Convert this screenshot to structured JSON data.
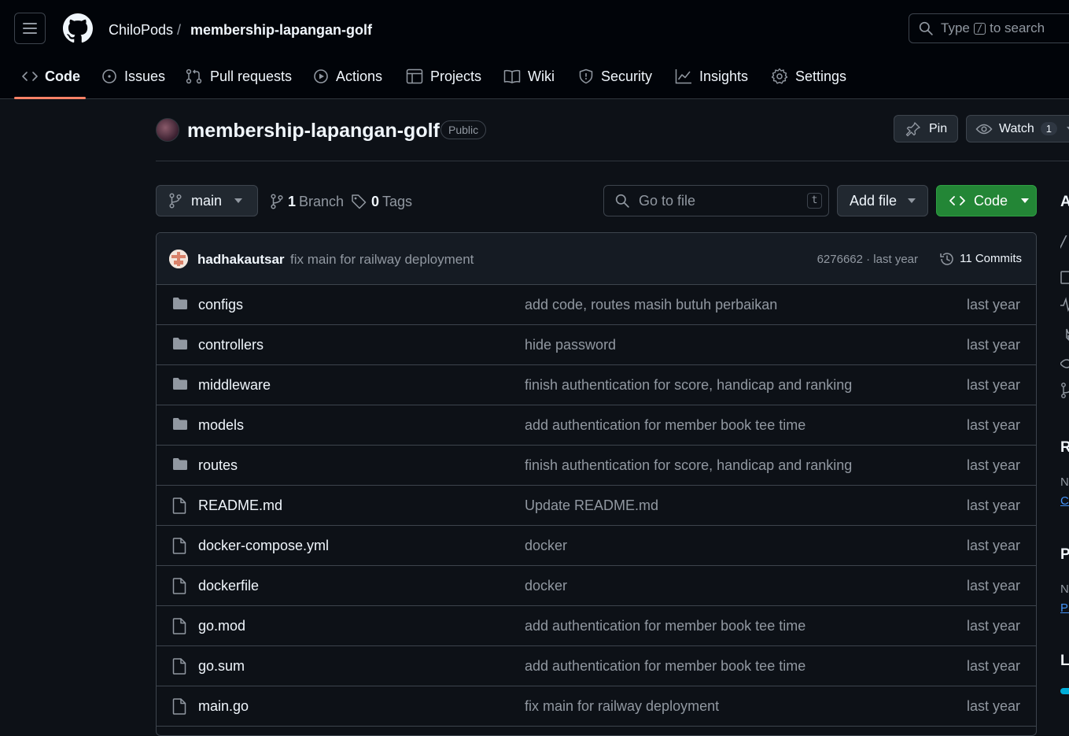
{
  "header": {
    "owner": "ChiloPods",
    "separator": "/",
    "repo": "membership-lapangan-golf",
    "search": {
      "prefix": "Type",
      "key": "/",
      "suffix": "to search"
    }
  },
  "tabs": [
    {
      "label": "Code",
      "icon": "code-icon",
      "selected": true
    },
    {
      "label": "Issues",
      "icon": "issue-icon"
    },
    {
      "label": "Pull requests",
      "icon": "pull-request-icon"
    },
    {
      "label": "Actions",
      "icon": "play-icon"
    },
    {
      "label": "Projects",
      "icon": "table-icon"
    },
    {
      "label": "Wiki",
      "icon": "book-icon"
    },
    {
      "label": "Security",
      "icon": "shield-icon"
    },
    {
      "label": "Insights",
      "icon": "graph-icon"
    },
    {
      "label": "Settings",
      "icon": "gear-icon"
    }
  ],
  "repo": {
    "title": "membership-lapangan-golf",
    "visibility": "Public",
    "pin_label": "Pin",
    "watch_label": "Watch",
    "watch_count": "1"
  },
  "toolbar": {
    "branch": "main",
    "branch_count": "1",
    "branch_label": "Branch",
    "tag_count": "0",
    "tag_label": "Tags",
    "goto_placeholder": "Go to file",
    "goto_key": "t",
    "add_file_label": "Add file",
    "code_label": "Code"
  },
  "latest_commit": {
    "author": "hadhakautsar",
    "message": "fix main for railway deployment",
    "hash_time": "6276662 · last year",
    "commits_label": "11 Commits"
  },
  "files": [
    {
      "type": "dir",
      "name": "configs",
      "message": "add code, routes masih butuh perbaikan",
      "date": "last year"
    },
    {
      "type": "dir",
      "name": "controllers",
      "message": "hide password",
      "date": "last year"
    },
    {
      "type": "dir",
      "name": "middleware",
      "message": "finish authentication for score, handicap and ranking",
      "date": "last year"
    },
    {
      "type": "dir",
      "name": "models",
      "message": "add authentication for member book tee time",
      "date": "last year"
    },
    {
      "type": "dir",
      "name": "routes",
      "message": "finish authentication for score, handicap and ranking",
      "date": "last year"
    },
    {
      "type": "file",
      "name": "README.md",
      "message": "Update README.md",
      "date": "last year"
    },
    {
      "type": "file",
      "name": "docker-compose.yml",
      "message": "docker",
      "date": "last year"
    },
    {
      "type": "file",
      "name": "dockerfile",
      "message": "docker",
      "date": "last year"
    },
    {
      "type": "file",
      "name": "go.mod",
      "message": "add authentication for member book tee time",
      "date": "last year"
    },
    {
      "type": "file",
      "name": "go.sum",
      "message": "add authentication for member book tee time",
      "date": "last year"
    },
    {
      "type": "file",
      "name": "main.go",
      "message": "fix main for railway deployment",
      "date": "last year"
    }
  ],
  "sidebar": {
    "about_initial": "A",
    "releases_initial": "R",
    "releases_none": "N",
    "releases_link": "Cr",
    "packages_initial": "P",
    "packages_none": "N",
    "packages_link": "Pu",
    "languages_initial": "L"
  },
  "colors": {
    "background": "#0d1117",
    "header": "#010409",
    "accent_underline": "#f78166",
    "code_button": "#238636",
    "link": "#4493f8"
  }
}
